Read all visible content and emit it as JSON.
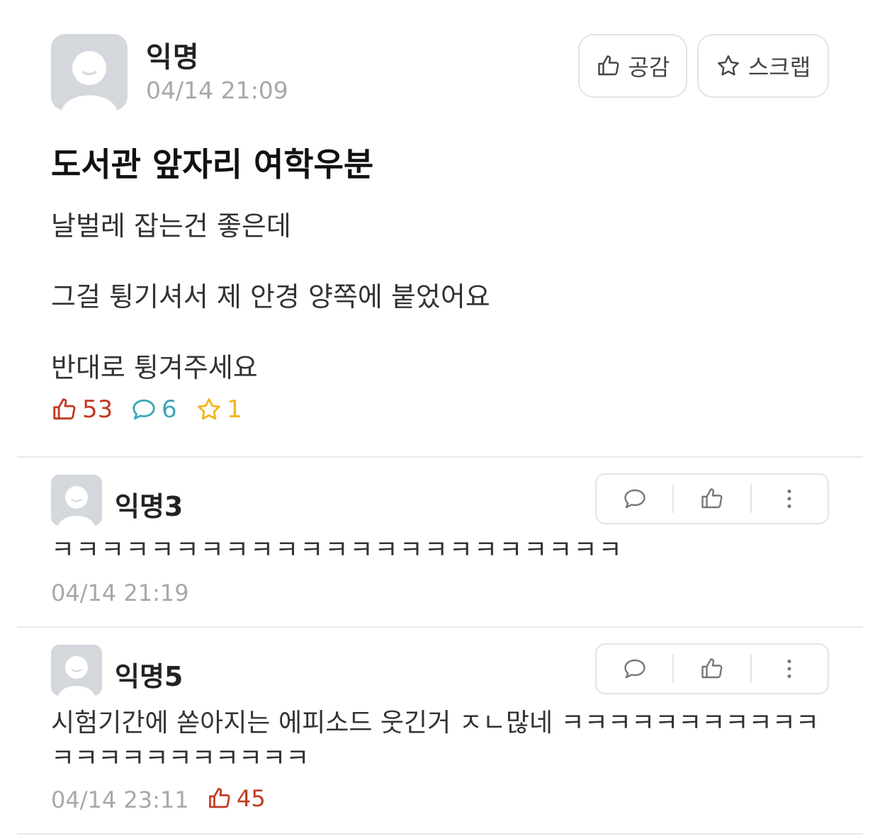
{
  "post": {
    "author": "익명",
    "time": "04/14 21:09",
    "like_button_label": "공감",
    "scrap_button_label": "스크랩",
    "title": "도서관 앞자리 여학우분",
    "body_lines": [
      "날벌레 잡는건 좋은데",
      "그걸 튕기셔서 제 안경 양쪽에 붙었어요",
      "반대로 튕겨주세요"
    ],
    "stats": {
      "likes": "53",
      "comments": "6",
      "scraps": "1"
    }
  },
  "comments": [
    {
      "author": "익명3",
      "text": "ㅋㅋㅋㅋㅋㅋㅋㅋㅋㅋㅋㅋㅋㅋㅋㅋㅋㅋㅋㅋㅋㅋㅋ",
      "time": "04/14 21:19"
    },
    {
      "author": "익명5",
      "text": "시험기간에 쏟아지는 에피소드 웃긴거 ㅈㄴ많네 ㅋㅋㅋㅋㅋㅋㅋㅋㅋㅋㅋㅋㅋㅋㅋㅋㅋㅋㅋㅋㅋㅋ",
      "time": "04/14 23:11",
      "likes": "45"
    }
  ],
  "colors": {
    "like": "#c23a22",
    "comment": "#3aa8b8",
    "scrap": "#f2b51e",
    "muted": "#a8a8a8"
  }
}
